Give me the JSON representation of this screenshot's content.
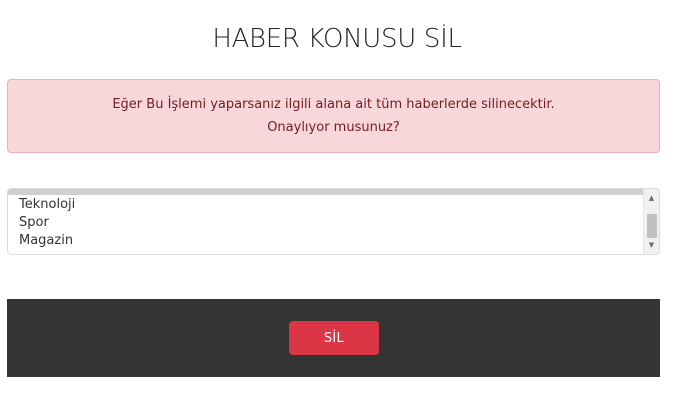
{
  "page": {
    "title": "HABER KONUSU SİL"
  },
  "alert": {
    "line1": "Eğer Bu İşlemi yaparsanız ilgili alana ait tüm haberlerde silinecektir.",
    "line2": "Onaylıyor musunuz?"
  },
  "category_select": {
    "options": [
      {
        "label": "Teknoloji"
      },
      {
        "label": "Spor"
      },
      {
        "label": "Magazin"
      }
    ]
  },
  "footer": {
    "delete_label": "SİL"
  },
  "colors": {
    "alert_bg": "#f8d7da",
    "alert_text": "#721c24",
    "footer_bg": "#343434",
    "delete_button": "#dc3545"
  },
  "icons": {
    "scroll_up": "scroll-up-arrow-icon",
    "scroll_down": "scroll-down-arrow-icon"
  }
}
